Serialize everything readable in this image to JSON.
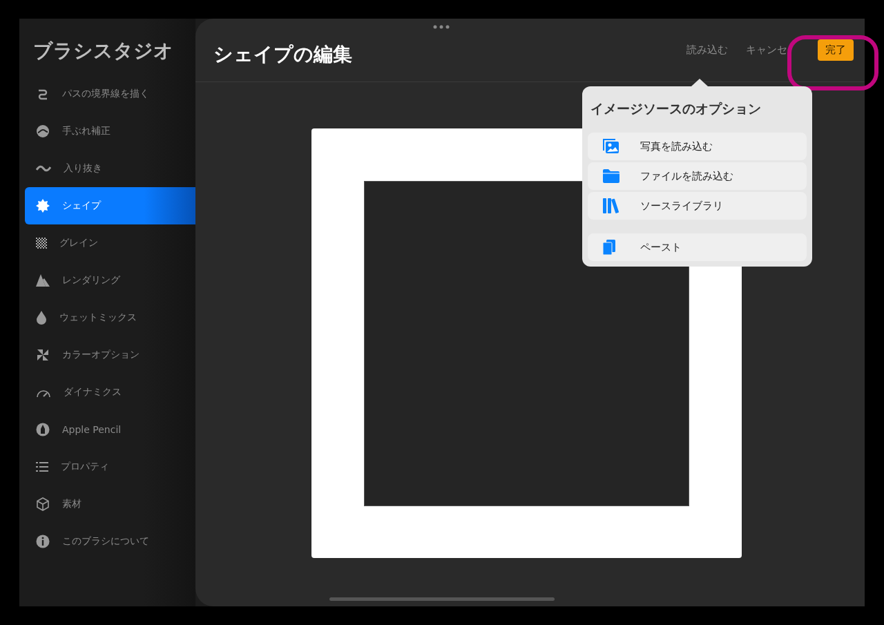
{
  "sidebar": {
    "title": "ブラシスタジオ",
    "items": [
      {
        "label": "パスの境界線を描く",
        "selected": false
      },
      {
        "label": "手ぶれ補正",
        "selected": false
      },
      {
        "label": "入り抜き",
        "selected": false
      },
      {
        "label": "シェイプ",
        "selected": true
      },
      {
        "label": "グレイン",
        "selected": false
      },
      {
        "label": "レンダリング",
        "selected": false
      },
      {
        "label": "ウェットミックス",
        "selected": false
      },
      {
        "label": "カラーオプション",
        "selected": false
      },
      {
        "label": "ダイナミクス",
        "selected": false
      },
      {
        "label": "Apple Pencil",
        "selected": false
      },
      {
        "label": "プロパティ",
        "selected": false
      },
      {
        "label": "素材",
        "selected": false
      },
      {
        "label": "このブラシについて",
        "selected": false
      }
    ]
  },
  "editor": {
    "title": "シェイプの編集",
    "actions": [
      {
        "label": "読み込む",
        "kind": "link"
      },
      {
        "label": "キャンセ",
        "kind": "link"
      },
      {
        "label": "完了",
        "kind": "primary"
      }
    ]
  },
  "popover": {
    "title": "イメージソースのオプション",
    "items": [
      {
        "label": "写真を読み込む",
        "kind": "photo"
      },
      {
        "label": "ファイルを読み込む",
        "kind": "folder"
      },
      {
        "label": "ソースライブラリ",
        "kind": "library"
      },
      {
        "label": "ペースト",
        "kind": "paste"
      }
    ]
  }
}
